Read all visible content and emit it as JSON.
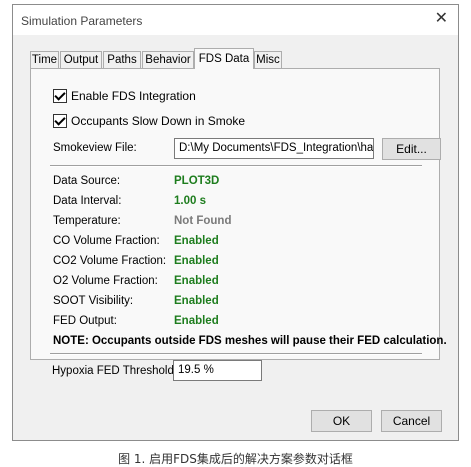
{
  "window": {
    "title": "Simulation Parameters"
  },
  "tabs": [
    {
      "label": "Time"
    },
    {
      "label": "Output"
    },
    {
      "label": "Paths"
    },
    {
      "label": "Behavior"
    },
    {
      "label": "FDS Data",
      "active": true
    },
    {
      "label": "Misc"
    }
  ],
  "fds": {
    "enable_label": "Enable FDS Integration",
    "enable_checked": true,
    "slowdown_label": "Occupants Slow Down in Smoke",
    "slowdown_checked": true,
    "smokeview_label": "Smokeview File:",
    "smokeview_value": "D:\\My Documents\\FDS_Integration\\hallway",
    "edit_label": "Edit...",
    "rows": [
      {
        "label": "Data Source:",
        "value": "PLOT3D",
        "status": "green"
      },
      {
        "label": "Data Interval:",
        "value": "1.00 s",
        "status": "green"
      },
      {
        "label": "Temperature:",
        "value": "Not Found",
        "status": "gray"
      },
      {
        "label": "CO Volume Fraction:",
        "value": "Enabled",
        "status": "green"
      },
      {
        "label": "CO2 Volume Fraction:",
        "value": "Enabled",
        "status": "green"
      },
      {
        "label": "O2 Volume Fraction:",
        "value": "Enabled",
        "status": "green"
      },
      {
        "label": "SOOT Visibility:",
        "value": "Enabled",
        "status": "green"
      },
      {
        "label": "FED Output:",
        "value": "Enabled",
        "status": "green"
      }
    ],
    "note": "NOTE: Occupants outside FDS meshes will pause their FED calculation.",
    "hypoxia_label": "Hypoxia FED Threshold:",
    "hypoxia_value": "19.5 %"
  },
  "buttons": {
    "ok": "OK",
    "cancel": "Cancel"
  },
  "caption": "图 1. 启用FDS集成后的解决方案参数对话框",
  "colors": {
    "enabled": "#1e7d1e",
    "not_found": "#7a7a7a"
  }
}
